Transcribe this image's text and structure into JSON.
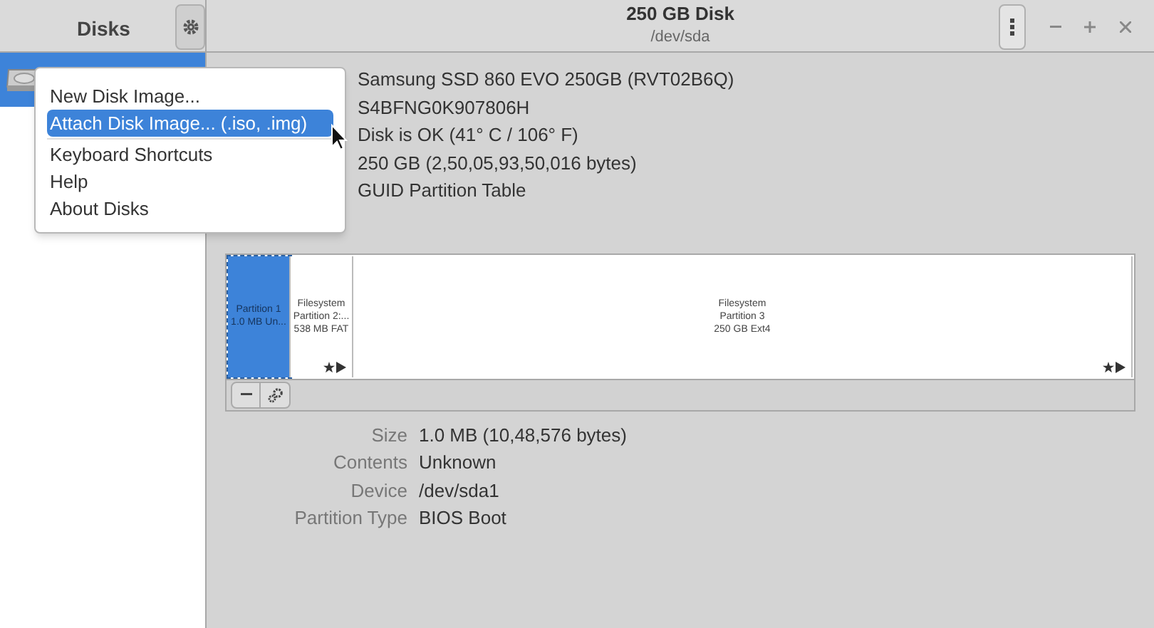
{
  "sidebar": {
    "title": "Disks",
    "items": [
      {
        "kind": "disk",
        "selected": true
      }
    ]
  },
  "header": {
    "title": "250 GB Disk",
    "subtitle": "/dev/sda"
  },
  "disk_info": [
    "Samsung SSD 860 EVO 250GB (RVT02B6Q)",
    "S4BFNG0K907806H",
    "Disk is OK (41° C / 106° F)",
    "250 GB (2,50,05,93,50,016 bytes)",
    "GUID Partition Table"
  ],
  "partitions": [
    {
      "lines": [
        "Partition 1",
        "1.0 MB Un..."
      ],
      "selected": true,
      "flags": false
    },
    {
      "lines": [
        "Filesystem",
        "Partition 2:...",
        "538 MB FAT"
      ],
      "selected": false,
      "flags": true
    },
    {
      "lines": [
        "Filesystem",
        "Partition 3",
        "250 GB Ext4"
      ],
      "selected": false,
      "flags": true
    }
  ],
  "properties": [
    {
      "label": "Size",
      "value": "1.0 MB (10,48,576 bytes)"
    },
    {
      "label": "Contents",
      "value": "Unknown"
    },
    {
      "label": "Device",
      "value": "/dev/sda1"
    },
    {
      "label": "Partition Type",
      "value": "BIOS Boot"
    }
  ],
  "menu": {
    "items": [
      {
        "label": "New Disk Image...",
        "selected": false,
        "kind": "item"
      },
      {
        "label": "Attach Disk Image... (.iso, .img)",
        "selected": true,
        "kind": "item"
      },
      {
        "kind": "separator"
      },
      {
        "label": "Keyboard Shortcuts",
        "selected": false,
        "kind": "item"
      },
      {
        "label": "Help",
        "selected": false,
        "kind": "item"
      },
      {
        "label": "About Disks",
        "selected": false,
        "kind": "item"
      }
    ]
  }
}
